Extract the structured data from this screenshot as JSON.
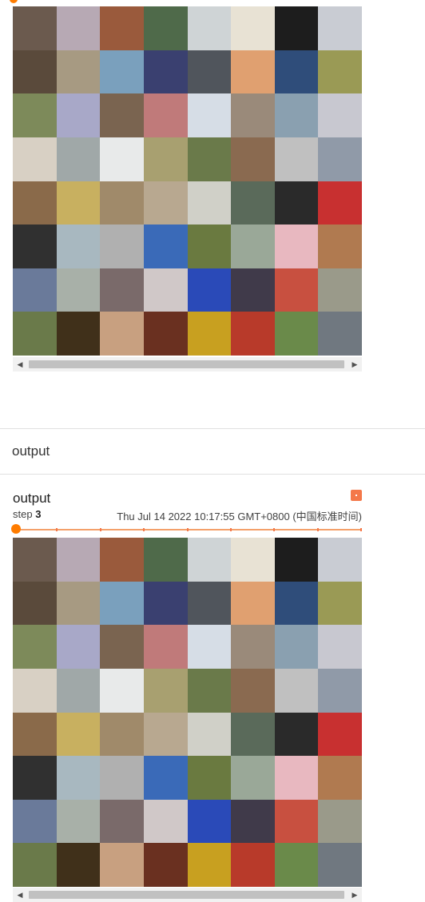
{
  "card1": {
    "image_grid": {
      "rows": 8,
      "cols": 8
    },
    "scrollbar": {
      "left_arrow": "◀",
      "right_arrow": "▶"
    }
  },
  "section": {
    "title": "output"
  },
  "card2": {
    "title": "output",
    "step_label": "step",
    "step_value": "3",
    "timestamp": "Thu Jul 14 2022 10:17:55 GMT+0800 (中国标准时间)",
    "step_slider": {
      "position": 0,
      "tick_count": 9
    },
    "image_grid": {
      "rows": 8,
      "cols": 8
    },
    "scrollbar": {
      "left_arrow": "◀",
      "right_arrow": "▶"
    },
    "expand_icon": "expand-icon"
  },
  "colors": {
    "accent": "#ff7c00",
    "divider": "#e0e0e0",
    "scroll_track": "#f1f1f1",
    "scroll_thumb": "#c1c1c1"
  }
}
